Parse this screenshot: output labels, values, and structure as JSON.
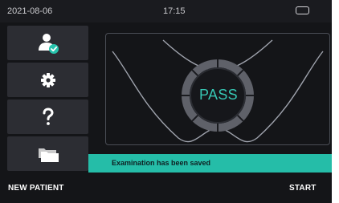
{
  "status_bar": {
    "date": "2021-08-06",
    "time": "17:15",
    "battery_icon": "battery-icon"
  },
  "sidebar": {
    "items": [
      {
        "name": "patient",
        "icon": "user-check-icon"
      },
      {
        "name": "settings",
        "icon": "gear-icon"
      },
      {
        "name": "help",
        "icon": "question-icon"
      },
      {
        "name": "records",
        "icon": "folders-icon"
      }
    ]
  },
  "main": {
    "result_text": "PASS",
    "toast_message": "Examination has been saved"
  },
  "footer": {
    "new_patient_label": "NEW PATIENT",
    "start_label": "START"
  },
  "colors": {
    "accent": "#25bda8",
    "background": "#141518",
    "sidebar_button": "#2c2d33",
    "status_bar": "#1a1b1f"
  }
}
